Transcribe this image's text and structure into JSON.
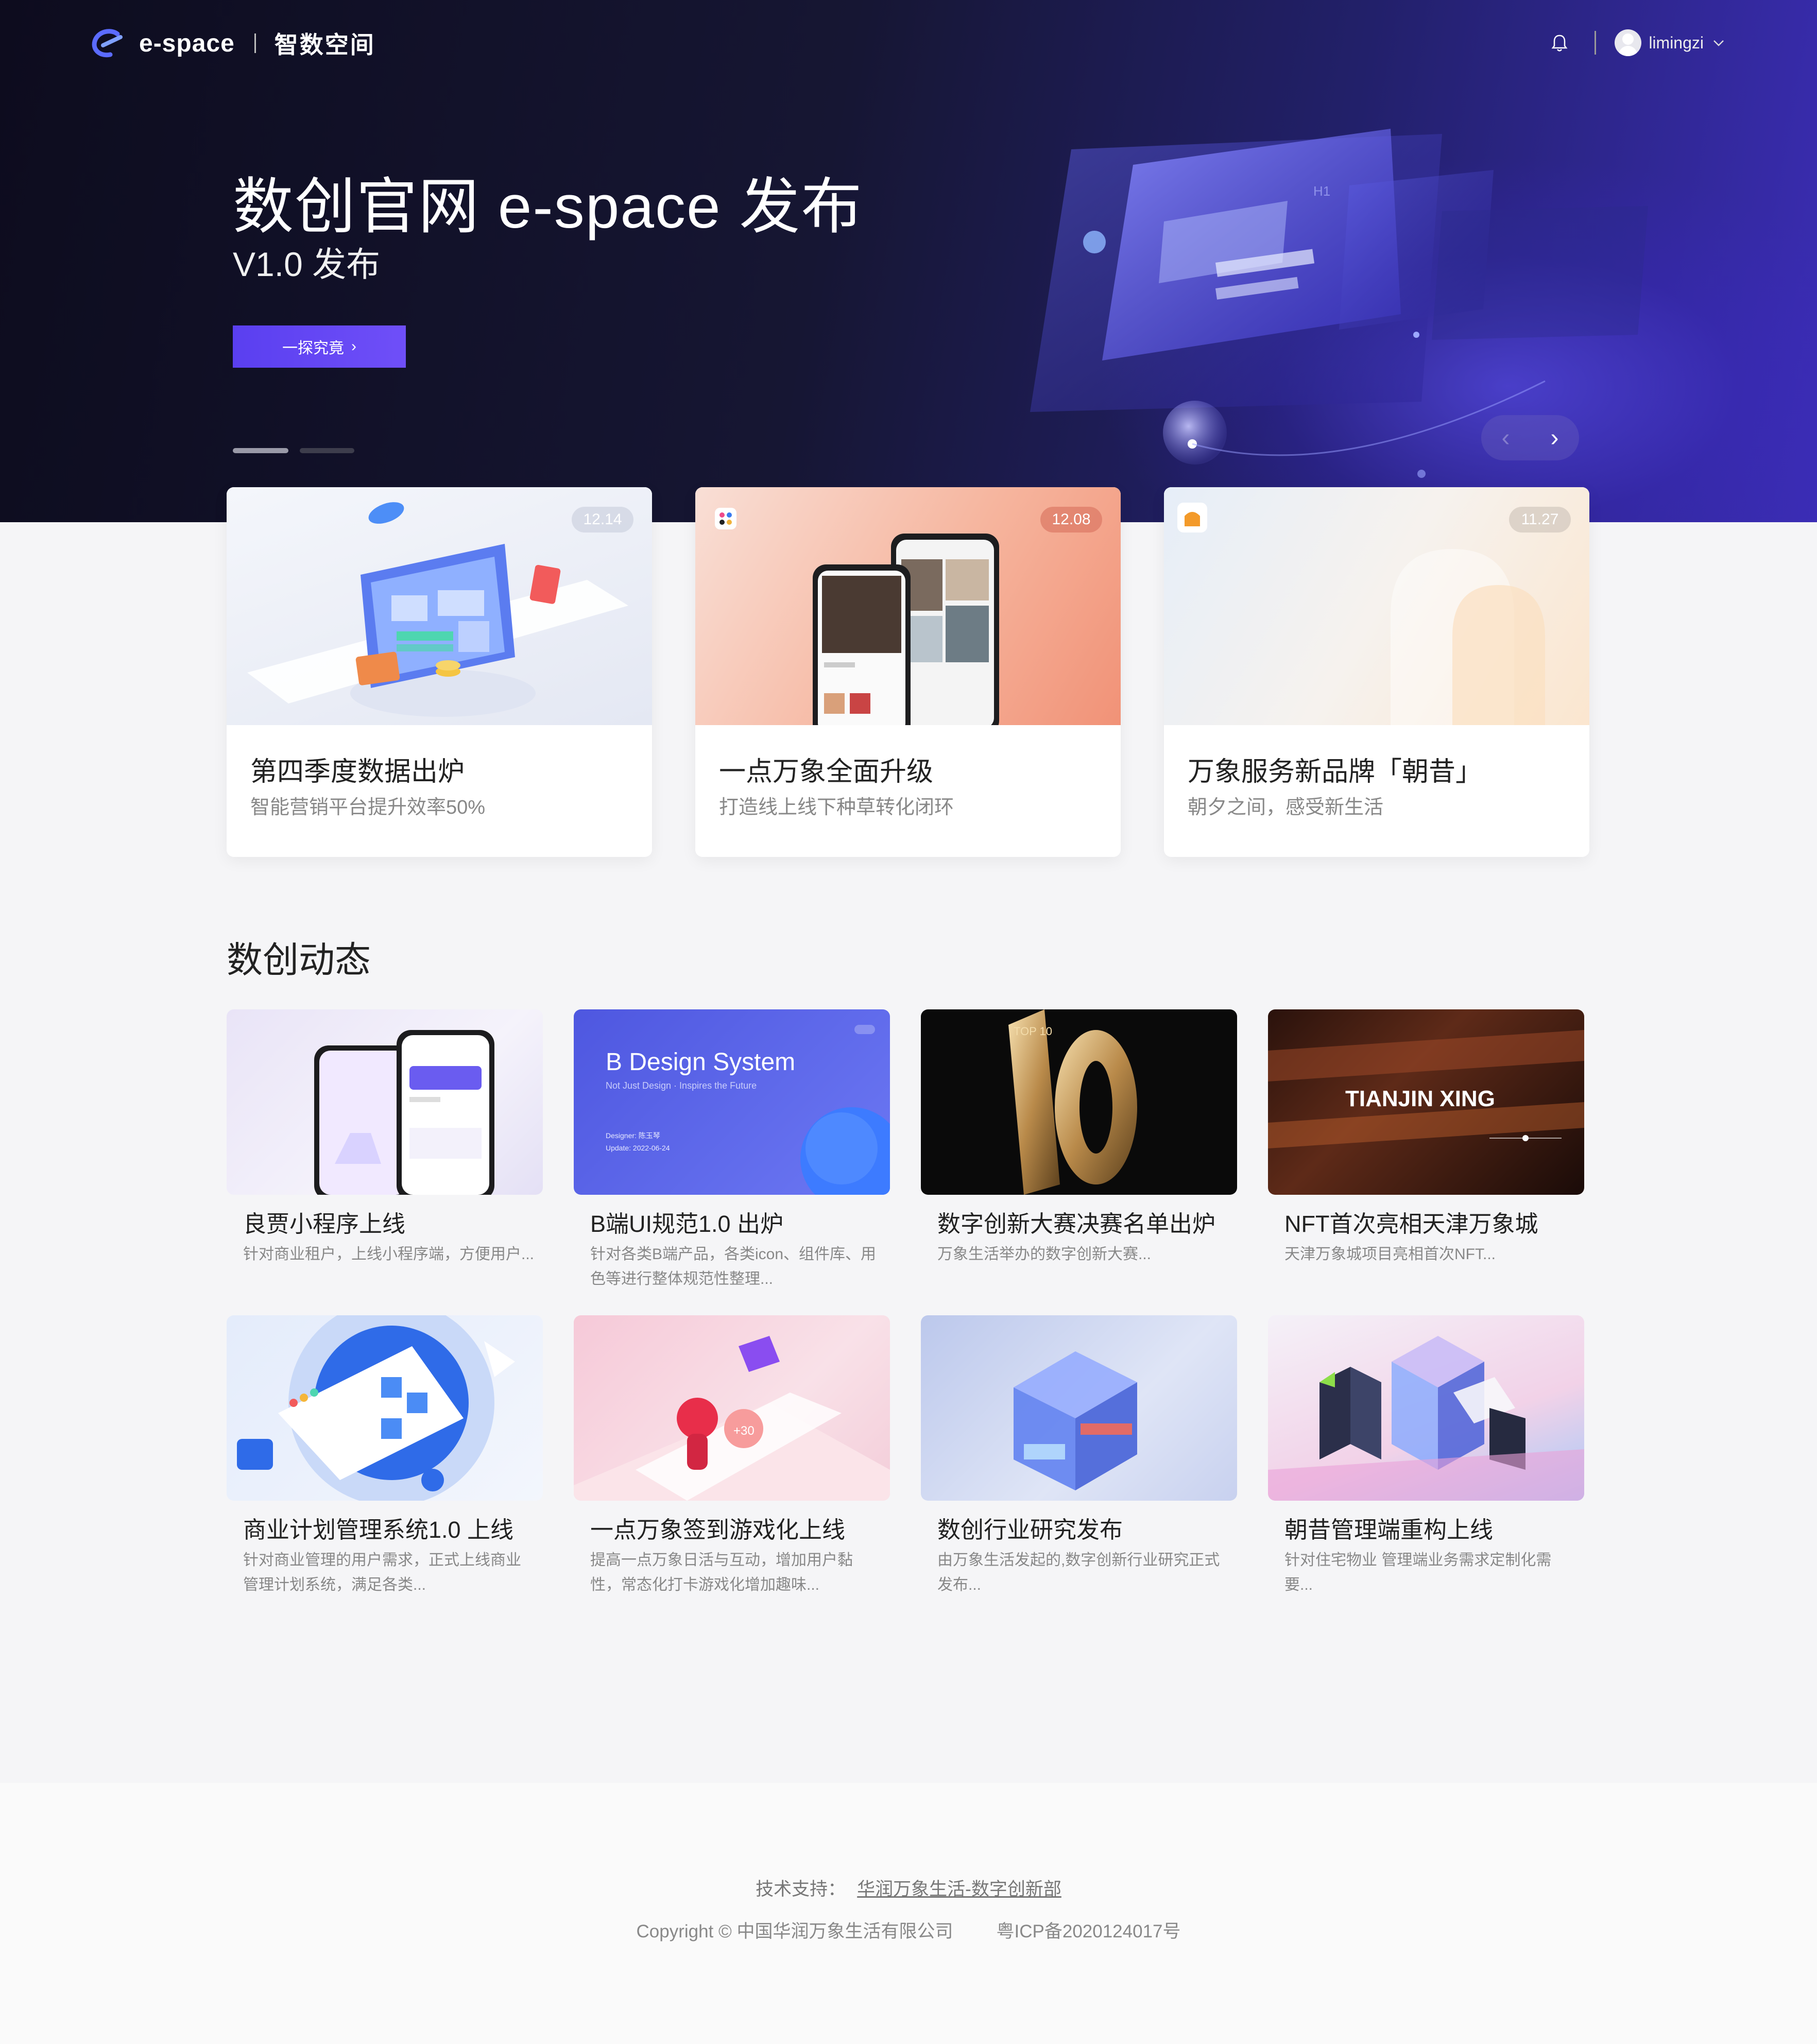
{
  "brand": {
    "name": "e-space",
    "cn_name": "智数空间"
  },
  "user": {
    "name": "limingzi"
  },
  "hero": {
    "title": "数创官网 e-space 发布",
    "subtitle": "V1.0 发布",
    "cta": "一探究竟",
    "active_slide": 1,
    "slide_count": 2
  },
  "features": [
    {
      "date": "12.14",
      "title": "第四季度数据出炉",
      "desc": "智能营销平台提升效率50%"
    },
    {
      "date": "12.08",
      "title": "一点万象全面升级",
      "desc": "打造线上线下种草转化闭环"
    },
    {
      "date": "11.27",
      "title": "万象服务新品牌「朝昔」",
      "desc": "朝夕之间，感受新生活"
    }
  ],
  "news_section": {
    "title": "数创动态"
  },
  "news": [
    {
      "title": "良贾小程序上线",
      "desc": "针对商业租户，上线小程序端，方便用户..."
    },
    {
      "title": "B端UI规范1.0 出炉",
      "desc": "针对各类B端产品，各类icon、组件库、用色等进行整体规范性整理...",
      "image_title": "B Design System",
      "image_tagline": "Not Just Design · Inspires the Future",
      "image_designer": "Designer: 陈玉琴",
      "image_update": "Update: 2022-06-24"
    },
    {
      "title": "数字创新大赛决赛名单出炉",
      "desc": "万象生活举办的数字创新大赛...",
      "image_text": "TOP 10"
    },
    {
      "title": "NFT首次亮相天津万象城",
      "desc": "天津万象城项目亮相首次NFT...",
      "image_text": "TIANJIN XING"
    },
    {
      "title": "商业计划管理系统1.0 上线",
      "desc": "针对商业管理的用户需求，正式上线商业管理计划系统，满足各类..."
    },
    {
      "title": "一点万象签到游戏化上线",
      "desc": "提高一点万象日活与互动，增加用户黏性，常态化打卡游戏化增加趣味...",
      "image_badge": "+30"
    },
    {
      "title": "数创行业研究发布",
      "desc": "由万象生活发起的,数字创新行业研究正式发布..."
    },
    {
      "title": "朝昔管理端重构上线",
      "desc": "针对住宅物业 管理端业务需求定制化需要..."
    }
  ],
  "footer": {
    "support_label": "技术支持：",
    "support_link": "华润万象生活-数字创新部",
    "copyright": "Copyright © 中国华润万象生活有限公司",
    "icp": "粤ICP备2020124017号"
  },
  "colors": {
    "accent": "#6a4cf6",
    "hero_bg": "#14132c",
    "page_bg": "#f5f5f7"
  },
  "icons": [
    "logo-mark-icon",
    "bell-icon",
    "avatar-icon",
    "chevron-down-icon",
    "chevron-right-icon",
    "chevron-left-icon"
  ]
}
